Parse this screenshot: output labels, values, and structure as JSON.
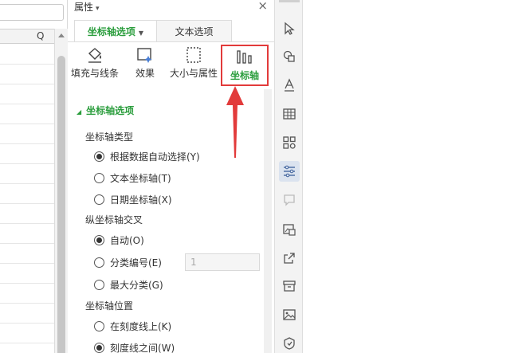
{
  "sheet": {
    "column_label": "Q"
  },
  "panel": {
    "title": "属性",
    "tabs": [
      {
        "label": "坐标轴选项",
        "active": true
      },
      {
        "label": "文本选项",
        "active": false
      }
    ],
    "categories": [
      {
        "label": "填充与线条",
        "icon": "fill-bucket-icon"
      },
      {
        "label": "效果",
        "icon": "effects-icon"
      },
      {
        "label": "大小与属性",
        "icon": "size-properties-icon"
      },
      {
        "label": "坐标轴",
        "icon": "axis-bars-icon",
        "selected": true
      }
    ],
    "section_title": "坐标轴选项",
    "axis_type": {
      "label": "坐标轴类型",
      "options": [
        {
          "label": "根据数据自动选择(Y)",
          "checked": true
        },
        {
          "label": "文本坐标轴(T)",
          "checked": false
        },
        {
          "label": "日期坐标轴(X)",
          "checked": false
        }
      ]
    },
    "vertical_cross": {
      "label": "纵坐标轴交叉",
      "options": [
        {
          "label": "自动(O)",
          "checked": true
        },
        {
          "label": "分类编号(E)",
          "checked": false
        },
        {
          "label": "最大分类(G)",
          "checked": false
        }
      ],
      "category_number_value": "1"
    },
    "axis_position": {
      "label": "坐标轴位置",
      "options": [
        {
          "label": "在刻度线上(K)",
          "checked": false
        },
        {
          "label": "刻度线之间(W)",
          "checked": true
        }
      ]
    }
  },
  "colors": {
    "accent_green": "#2a9d3c",
    "highlight_red": "#e23b3b"
  },
  "toolbar_icons": [
    "select-cursor-icon",
    "shapes-icon",
    "text-style-icon",
    "table-icon",
    "grid-apps-icon",
    "properties-sliders-icon",
    "comment-icon",
    "image-gallery-icon",
    "share-icon",
    "archive-icon",
    "picture-icon",
    "shield-icon"
  ]
}
